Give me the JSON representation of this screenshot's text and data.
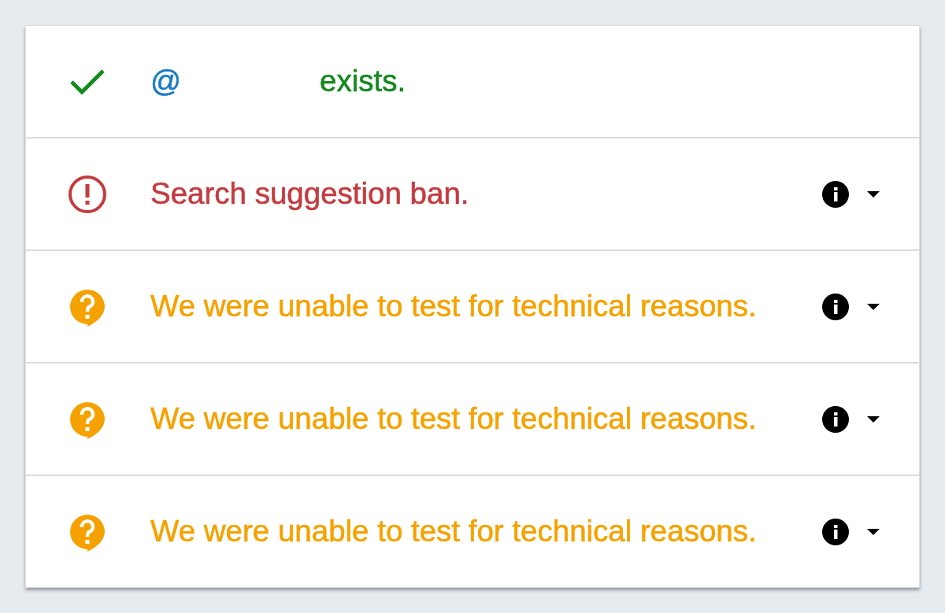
{
  "results": [
    {
      "kind": "success",
      "handle": "@",
      "text": "exists.",
      "expandable": false
    },
    {
      "kind": "ban",
      "text": "Search suggestion ban.",
      "expandable": true
    },
    {
      "kind": "unknown",
      "text": "We were unable to test for technical reasons.",
      "expandable": true
    },
    {
      "kind": "unknown",
      "text": "We were unable to test for technical reasons.",
      "expandable": true
    },
    {
      "kind": "unknown",
      "text": "We were unable to test for technical reasons.",
      "expandable": true
    }
  ]
}
